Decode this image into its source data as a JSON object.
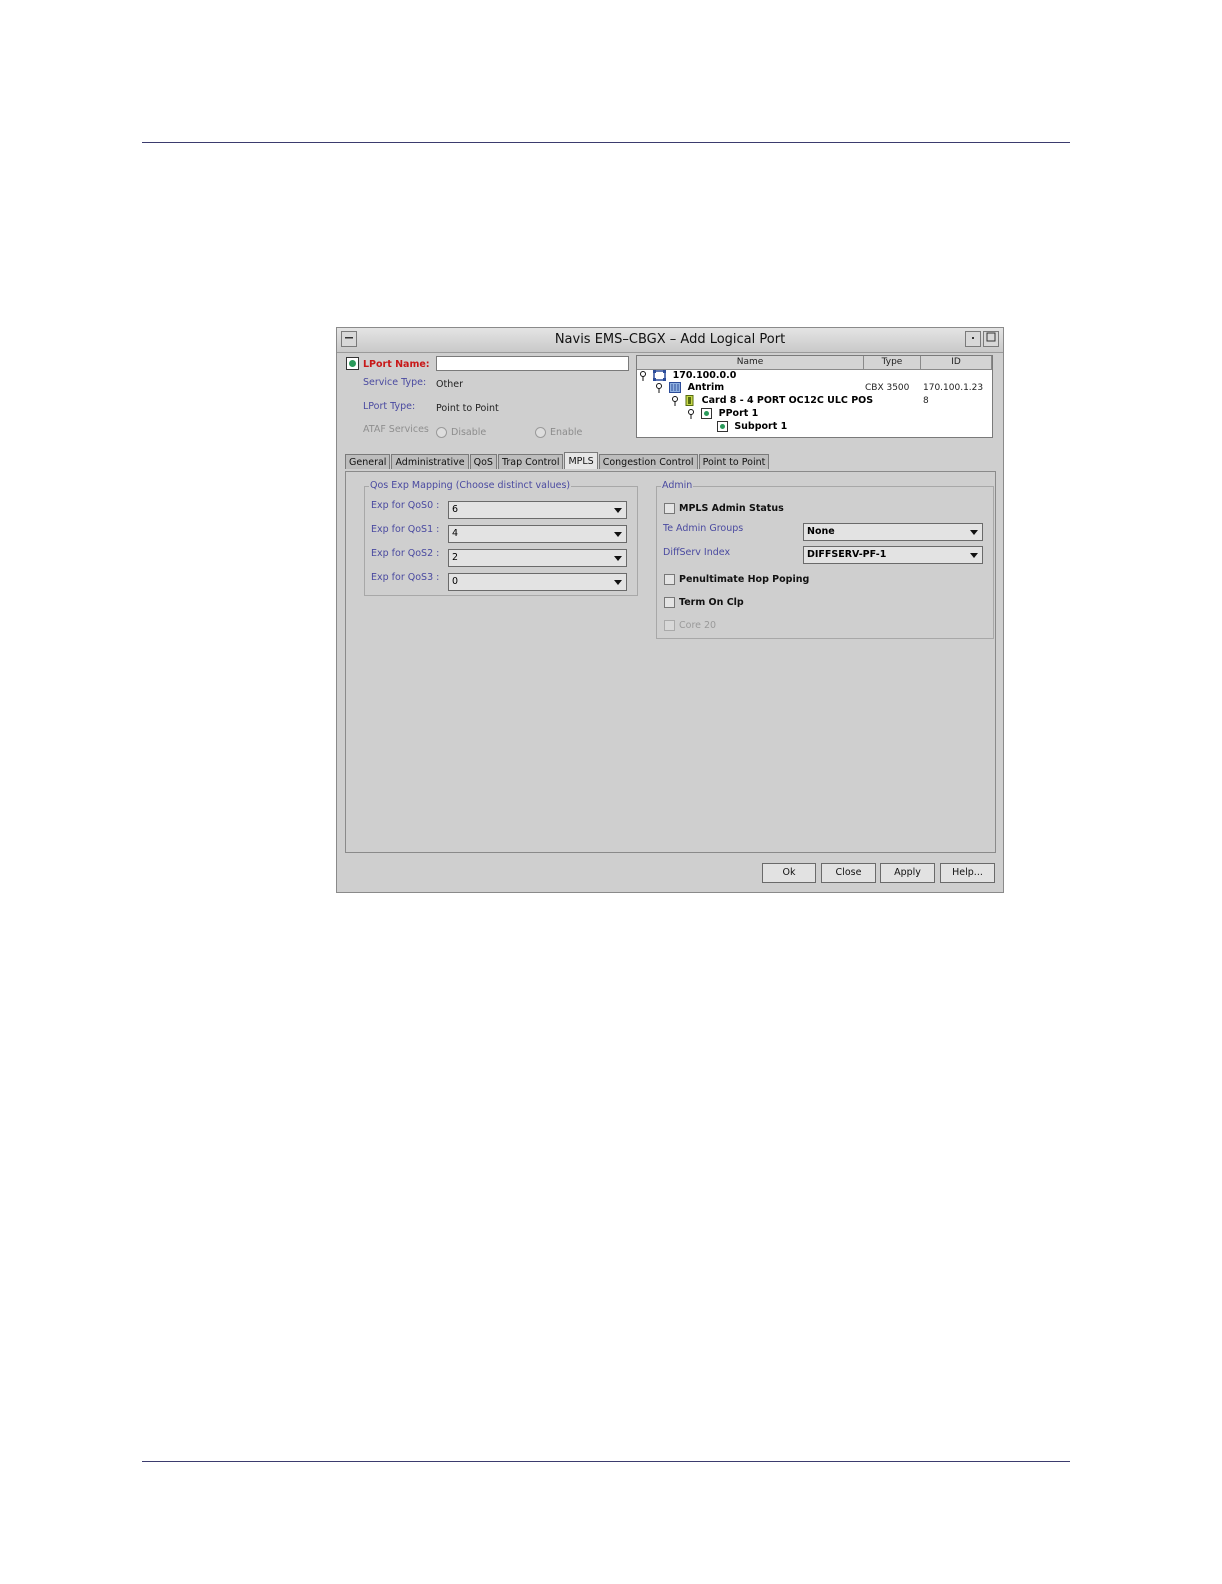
{
  "window": {
    "title": "Navis EMS–CBGX – Add Logical Port"
  },
  "header": {
    "lport_name_label": "LPort Name:",
    "lport_name_value": "",
    "service_type_label": "Service Type:",
    "service_type_value": "Other",
    "lport_type_label": "LPort Type:",
    "lport_type_value": "Point to Point",
    "ataf_label": "ATAF Services",
    "ataf_options": [
      "Disable",
      "Enable"
    ]
  },
  "tree": {
    "columns": [
      "Name",
      "Type",
      "ID"
    ],
    "rows": [
      {
        "name": "170.100.0.0",
        "type": "",
        "id": ""
      },
      {
        "name": "Antrim",
        "type": "CBX 3500",
        "id": "170.100.1.23"
      },
      {
        "name": "Card 8 - 4 PORT OC12C ULC POS",
        "type": "",
        "id": "8"
      },
      {
        "name": "PPort 1",
        "type": "",
        "id": ""
      },
      {
        "name": "Subport 1",
        "type": "",
        "id": ""
      }
    ]
  },
  "tabs": [
    "General",
    "Administrative",
    "QoS",
    "Trap Control",
    "MPLS",
    "Congestion Control",
    "Point to Point"
  ],
  "active_tab": "MPLS",
  "qos_exp": {
    "title": "Qos Exp Mapping (Choose distinct values)",
    "rows": [
      {
        "label": "Exp for QoS0 :",
        "value": "6"
      },
      {
        "label": "Exp for QoS1 :",
        "value": "4"
      },
      {
        "label": "Exp for QoS2 :",
        "value": "2"
      },
      {
        "label": "Exp for QoS3 :",
        "value": "0"
      }
    ]
  },
  "admin": {
    "title": "Admin",
    "mpls_admin_status": "MPLS Admin Status",
    "te_admin_groups_label": "Te Admin Groups",
    "te_admin_groups_value": "None",
    "diffserv_index_label": "DiffServ Index",
    "diffserv_index_value": "DIFFSERV-PF-1",
    "penultimate_hop": "Penultimate Hop Poping",
    "term_on_clp": "Term On Clp",
    "core_20": "Core 20"
  },
  "buttons": {
    "ok": "Ok",
    "close": "Close",
    "apply": "Apply",
    "help": "Help..."
  }
}
